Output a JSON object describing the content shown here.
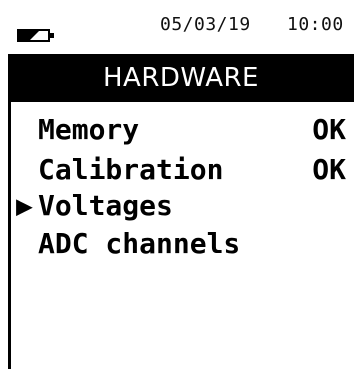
{
  "status": {
    "date": "05/03/19",
    "time": "10:00",
    "battery_icon": "battery-low-icon"
  },
  "header": {
    "title": "HARDWARE"
  },
  "menu": {
    "cursor": "▶",
    "selected_index": 2,
    "items": [
      {
        "label": "Memory",
        "value": "OK"
      },
      {
        "label": "Calibration",
        "value": "OK"
      },
      {
        "label": "Voltages",
        "value": ""
      },
      {
        "label": "ADC channels",
        "value": ""
      }
    ]
  },
  "colors": {
    "background": "#ffffff",
    "header_bg": "#000000",
    "header_text": "#ffffff",
    "text": "#000000"
  }
}
